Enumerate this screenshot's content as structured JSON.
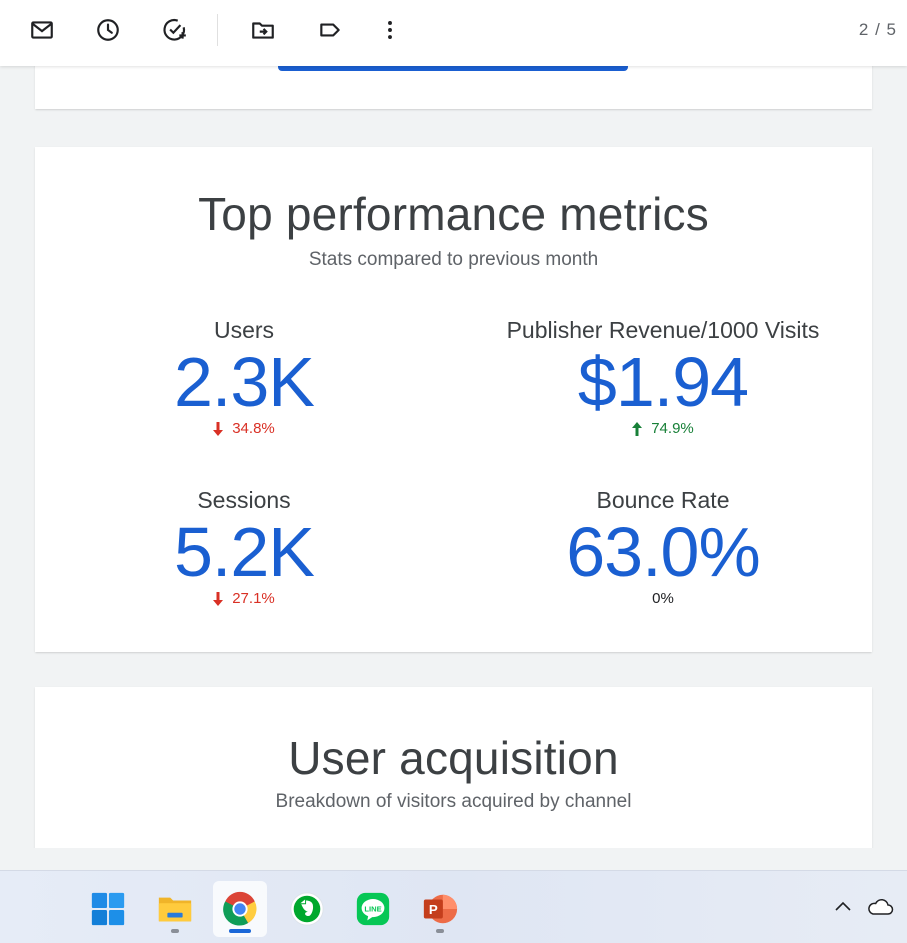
{
  "toolbar": {
    "icons": [
      "mail-icon",
      "clock-icon",
      "add-task-icon",
      "move-to-icon",
      "label-icon",
      "more-vert-icon"
    ],
    "pager": "2 / 5"
  },
  "metrics_card": {
    "title": "Top performance metrics",
    "subtitle": "Stats compared to previous month",
    "metrics": [
      {
        "label": "Users",
        "value": "2.3K",
        "change": "34.8%",
        "direction": "down",
        "color": "#d93025"
      },
      {
        "label": "Publisher Revenue/1000 Visits",
        "value": "$1.94",
        "change": "74.9%",
        "direction": "up",
        "color": "#188038"
      },
      {
        "label": "Sessions",
        "value": "5.2K",
        "change": "27.1%",
        "direction": "down",
        "color": "#d93025"
      },
      {
        "label": "Bounce Rate",
        "value": "63.0%",
        "change": "0%",
        "direction": "flat",
        "color": "#202124"
      }
    ]
  },
  "acquisition_card": {
    "title": "User acquisition",
    "subtitle": "Breakdown of visitors acquired by channel"
  },
  "taskbar": {
    "apps": [
      "windows-start-icon",
      "file-explorer-icon",
      "chrome-icon",
      "evernote-icon",
      "line-icon",
      "powerpoint-icon"
    ],
    "active_app": "chrome-icon",
    "tray": [
      "chevron-up-icon",
      "onedrive-cloud-icon"
    ]
  },
  "colors": {
    "accent": "#1a5fd1",
    "down": "#d93025",
    "up": "#188038"
  }
}
